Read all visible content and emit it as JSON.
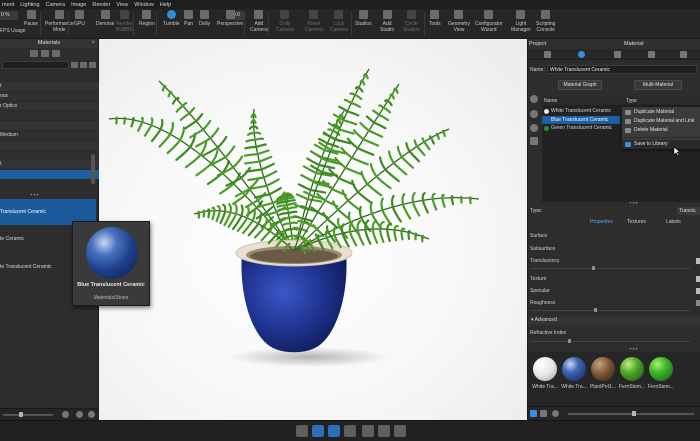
{
  "menubar": [
    "ment",
    "Lighting",
    "Camera",
    "Image",
    "Render",
    "View",
    "Window",
    "Help"
  ],
  "toolbar": {
    "fps_value": "0 %",
    "fps_label": "FPS Usage",
    "buttons": [
      {
        "label": "Pause",
        "state": "normal"
      },
      {
        "label": "Performance\nMode",
        "state": "normal"
      },
      {
        "label": "GPU",
        "state": "normal"
      },
      {
        "label": "Denoise",
        "state": "normal"
      },
      {
        "label": "Render\nBUBBS",
        "state": "dim"
      },
      {
        "label": "Region",
        "state": "normal"
      },
      {
        "label": "Tumble",
        "state": "active"
      },
      {
        "label": "Pan",
        "state": "normal"
      },
      {
        "label": "Dolly",
        "state": "normal"
      },
      {
        "label": "Perspective",
        "state": "normal"
      },
      {
        "label": "Add\nCamera",
        "state": "normal"
      },
      {
        "label": "Dolly\nCamera",
        "state": "dim"
      },
      {
        "label": "Reset\nCamera",
        "state": "dim"
      },
      {
        "label": "Lock\nCamera",
        "state": "dim"
      },
      {
        "label": "Studios",
        "state": "normal"
      },
      {
        "label": "Add\nStudio",
        "state": "normal"
      },
      {
        "label": "Cycle\nStudios",
        "state": "dim"
      },
      {
        "label": "Tools",
        "state": "normal"
      },
      {
        "label": "Geometry\nView",
        "state": "normal"
      },
      {
        "label": "Configurator\nWizard",
        "state": "normal"
      },
      {
        "label": "Light\nManager",
        "state": "normal"
      },
      {
        "label": "Scripting\nConsole",
        "state": "normal"
      }
    ],
    "zoom": "50.0"
  },
  "left_panel": {
    "title": "Materials",
    "close": "×",
    "tree": [
      {
        "label": "t"
      },
      {
        "label": "ous"
      },
      {
        "label": "r Optics"
      },
      {
        "label": ""
      },
      {
        "label": ""
      },
      {
        "label": "Medium"
      },
      {
        "label": ""
      },
      {
        "label": ""
      },
      {
        "label": "t"
      },
      {
        "label": ""
      }
    ],
    "library": [
      {
        "label": "Translucent Ceramic",
        "selected": true
      },
      {
        "label": "te Ceramic",
        "selected": false
      },
      {
        "label": "te Translucent Ceramic",
        "selected": false
      }
    ],
    "slider_value": 0.4
  },
  "tooltip": {
    "title": "Blue Translucent Ceramic",
    "path": "Materials/Stone"
  },
  "right_panel": {
    "tab_project": "Project",
    "tab_material": "Material",
    "name_label": "Name:",
    "name_value": "White Translucent Ceramic",
    "material_graph_button": "Material Graph",
    "multi_material_button": "Multi-Material",
    "list_headers": {
      "name": "Name",
      "type": "Type"
    },
    "materials": [
      {
        "name": "White Translucent Ceramic",
        "color": "#e8e8e8",
        "selected": false
      },
      {
        "name": "Blue Translucent Ceramic",
        "color": "#2a5fc0",
        "selected": true
      },
      {
        "name": "Green Translucent Ceramic",
        "color": "#2f8a3a",
        "selected": false
      }
    ],
    "context_menu": [
      "Duplicate Material",
      "Duplicate Material and Link",
      "Delete Material",
      "Save to Library"
    ],
    "type_label": "Type:",
    "type_value": "Translu",
    "prop_tabs": [
      "Properties",
      "Textures",
      "Labels"
    ],
    "properties": [
      "Surface",
      "Subsurface",
      "Translucency",
      "Texture",
      "Specular",
      "Roughness"
    ],
    "advanced": "Advanced",
    "refractive_index": "Refractive Index",
    "swatches": [
      {
        "label": "White Tra...",
        "color": "white"
      },
      {
        "label": "White Tra...",
        "color": "blue"
      },
      {
        "label": "PlantPot1...",
        "color": "brown"
      },
      {
        "label": "FernStem...",
        "color": "green"
      },
      {
        "label": "FernStem...",
        "color": "green2"
      }
    ]
  },
  "bottom_bar": [
    "info",
    "book",
    "list",
    "play",
    "cube",
    "box",
    "camera"
  ]
}
